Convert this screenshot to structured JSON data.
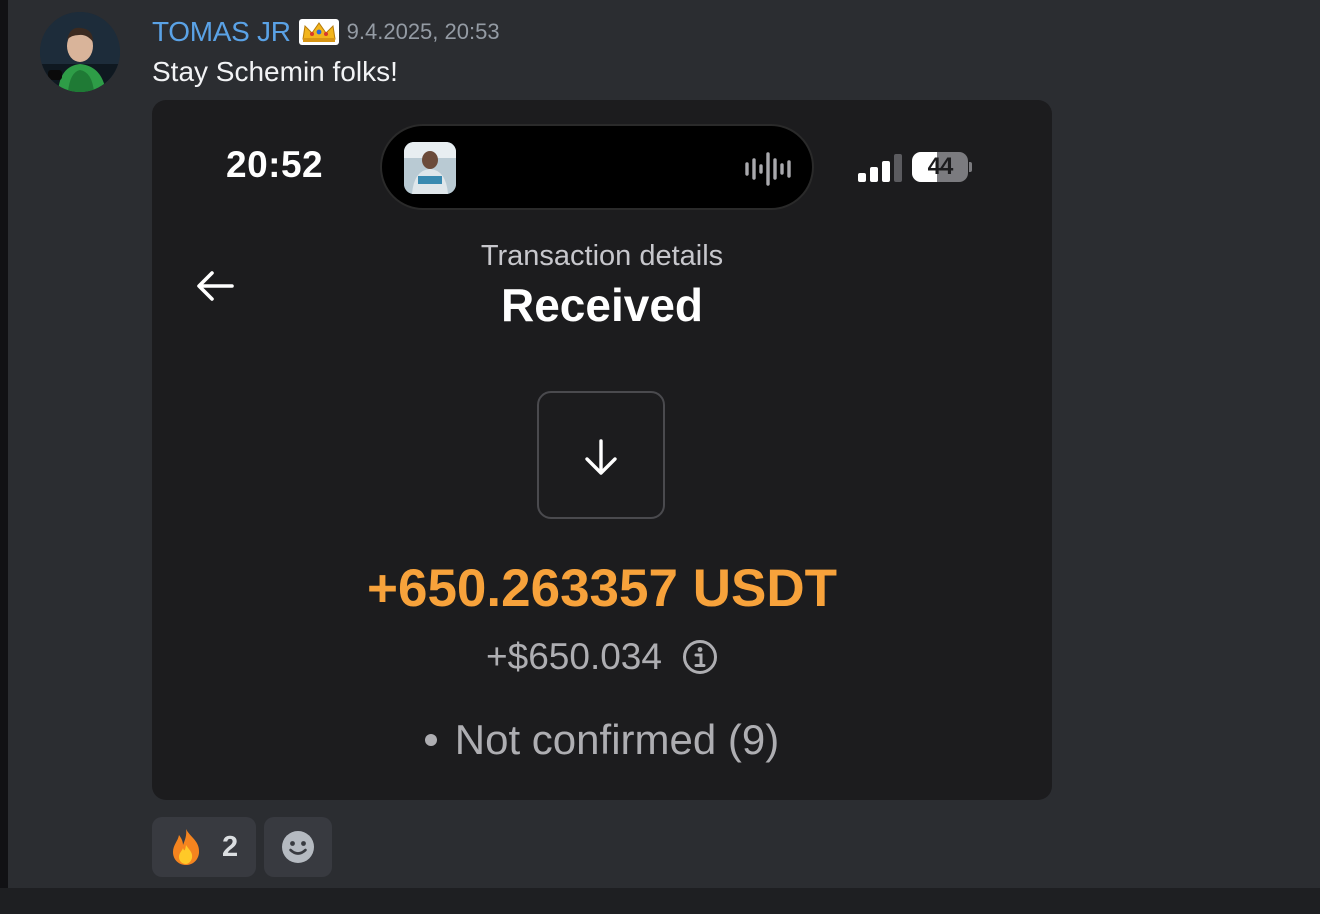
{
  "message": {
    "author": "TOMAS JR",
    "badge_icon": "crown-icon",
    "timestamp": "9.4.2025, 20:53",
    "text": "Stay Schemin folks!",
    "author_color": "#5aa2e6"
  },
  "embed": {
    "status_bar": {
      "time": "20:52",
      "battery": "44",
      "battery_level_percent": 44,
      "signal_bars_active": 3,
      "signal_bars_total": 4
    },
    "screen": {
      "subtitle": "Transaction details",
      "title": "Received",
      "direction_icon": "arrow-down-icon",
      "amount": "+650.263357 USDT",
      "fiat_amount": "+$650.034",
      "status": "Not confirmed (9)",
      "amount_color": "#f7a23b"
    }
  },
  "reactions": [
    {
      "emoji": "fire-icon",
      "count": "2"
    }
  ],
  "add_reaction_icon": "add-reaction-icon"
}
